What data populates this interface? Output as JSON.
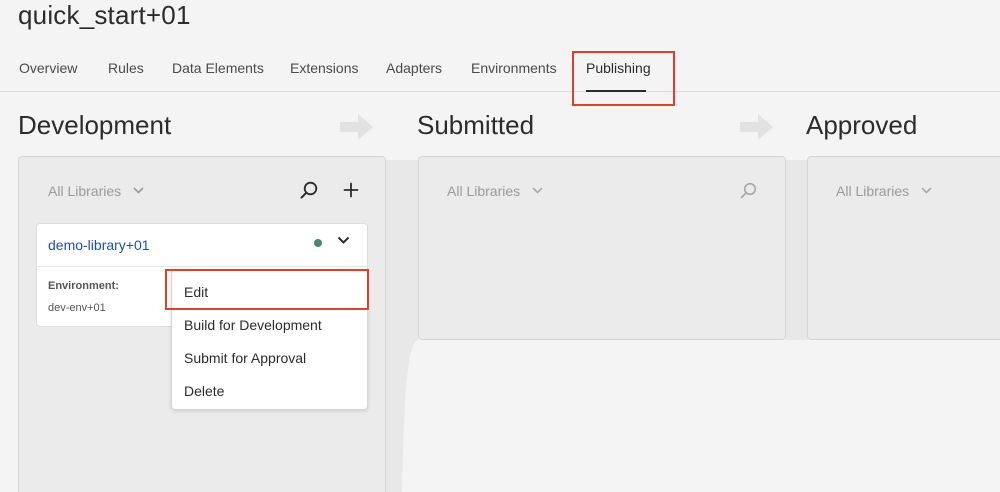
{
  "app": {
    "title": "quick_start+01"
  },
  "tabs": [
    {
      "label": "Overview"
    },
    {
      "label": "Rules"
    },
    {
      "label": "Data Elements"
    },
    {
      "label": "Extensions"
    },
    {
      "label": "Adapters"
    },
    {
      "label": "Environments"
    },
    {
      "label": "Publishing",
      "active": true
    }
  ],
  "columns": [
    {
      "title": "Development",
      "filter": "All Libraries"
    },
    {
      "title": "Submitted",
      "filter": "All Libraries"
    },
    {
      "title": "Approved",
      "filter": "All Libraries"
    }
  ],
  "library_card": {
    "name": "demo-library+01",
    "status_color": "#4a8a6b",
    "environment_label": "Environment:",
    "environment_value": "dev-env+01"
  },
  "context_menu": {
    "items": [
      {
        "label": "Edit"
      },
      {
        "label": "Build for Development"
      },
      {
        "label": "Submit for Approval"
      },
      {
        "label": "Delete"
      }
    ]
  },
  "icons": {
    "search": "search-icon",
    "add": "plus-icon",
    "chevron": "chevron-down-icon",
    "arrow": "arrow-right-icon"
  },
  "colors": {
    "highlight": "#e0402a",
    "link": "#1f4fae"
  }
}
